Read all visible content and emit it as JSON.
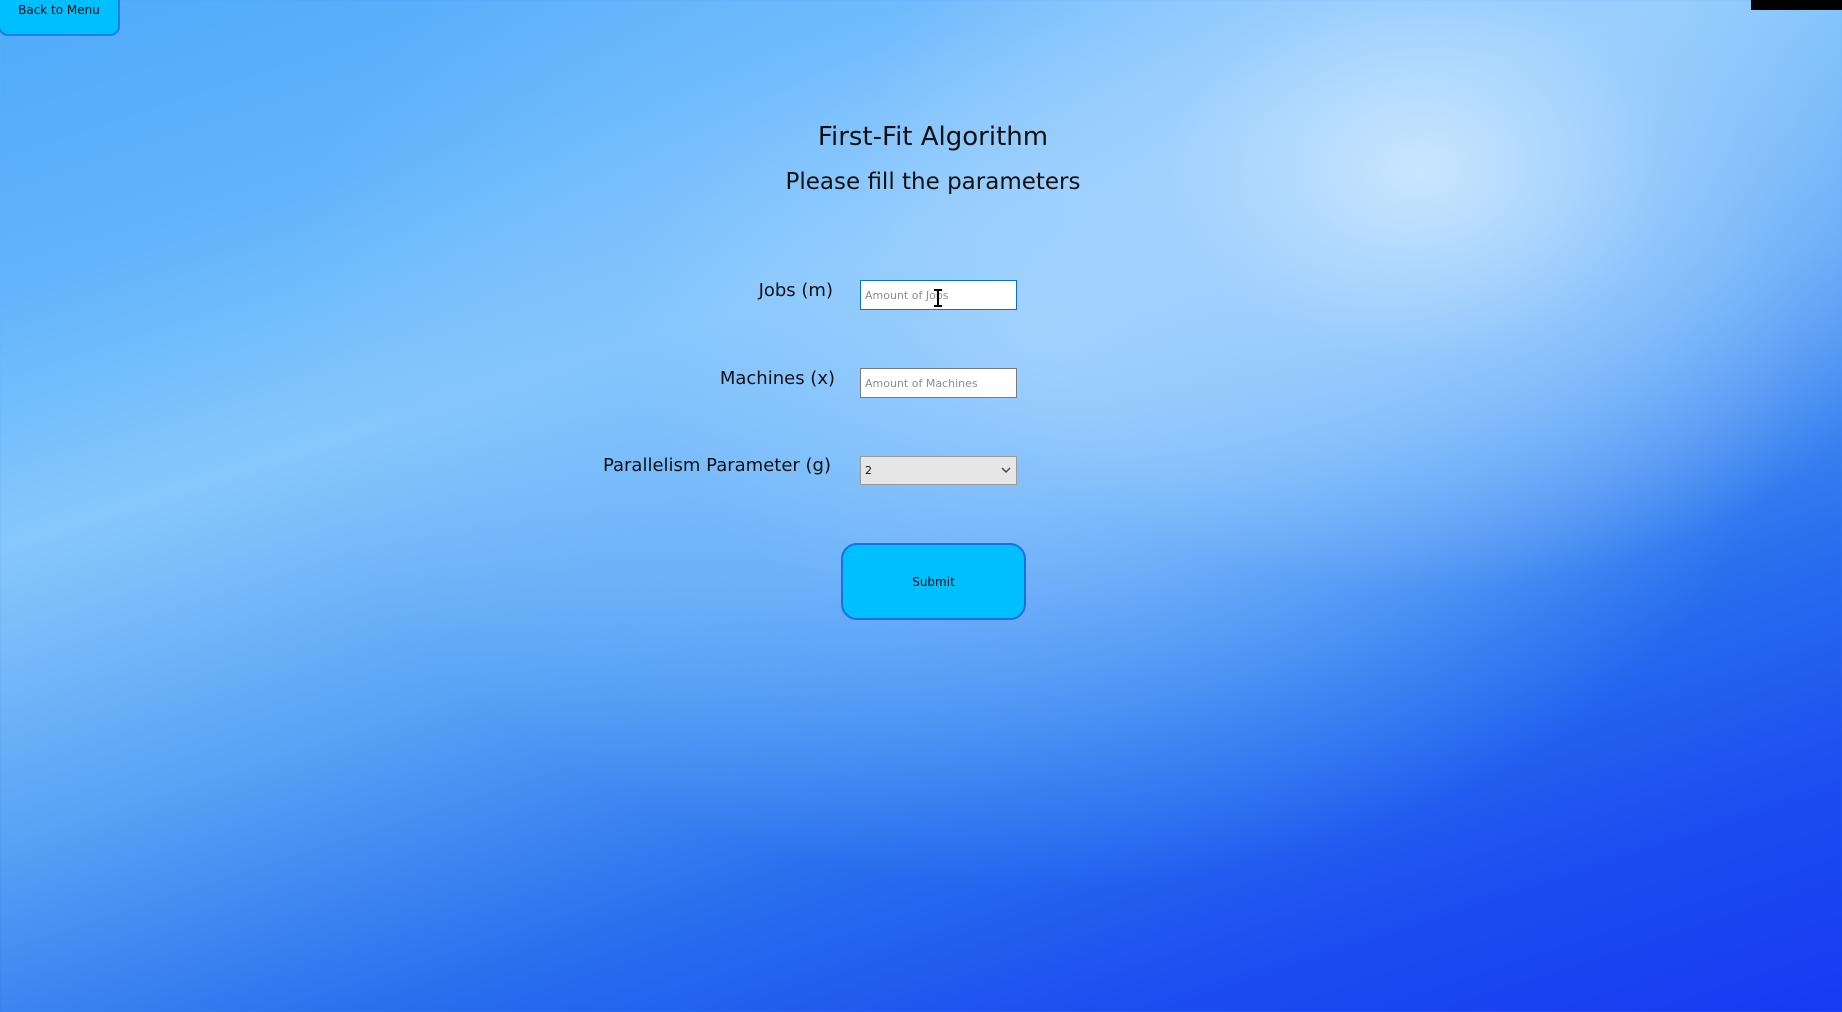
{
  "nav": {
    "back_label": "Back to Menu"
  },
  "header": {
    "title": "First-Fit Algorithm",
    "subtitle": "Please fill the parameters"
  },
  "form": {
    "jobs": {
      "label": "Jobs (m)",
      "placeholder": "Amount of Jobs",
      "value": ""
    },
    "machines": {
      "label": "Machines (x)",
      "placeholder": "Amount of Machines",
      "value": ""
    },
    "parallelism": {
      "label": "Parallelism Parameter (g)",
      "selected": "2"
    },
    "submit_label": "Submit"
  },
  "colors": {
    "button_fill": "#00bfff",
    "button_border": "#1e6fe3",
    "background_top": "#4faaf9",
    "background_bottom": "#1739f2"
  },
  "icons": {
    "dropdown": "chevron-down-icon",
    "cursor": "text-cursor-icon"
  }
}
